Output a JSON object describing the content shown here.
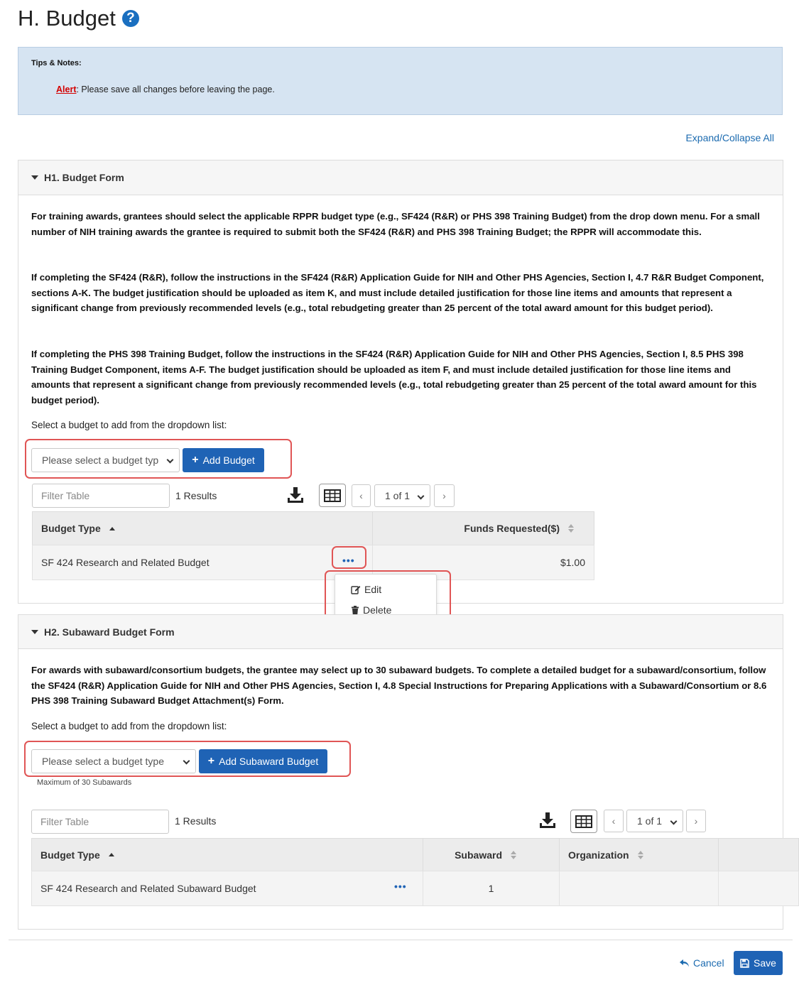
{
  "page": {
    "title": "H. Budget",
    "help_icon": "question-circle-icon"
  },
  "tips": {
    "title": "Tips & Notes:",
    "alert_label": "Alert",
    "alert_text": ": Please save all changes before leaving the page."
  },
  "expand_collapse_label": "Expand/Collapse All",
  "h1": {
    "title": "H1. Budget Form",
    "paragraphs": [
      "For training awards, grantees should select the applicable RPPR budget type (e.g., SF424 (R&R) or PHS 398 Training Budget) from the drop down menu. For a small number of NIH training awards the grantee is required to submit both the SF424 (R&R) and PHS 398 Training Budget; the RPPR will accommodate this.",
      "If completing the SF424 (R&R), follow the instructions in the SF424 (R&R) Application Guide for NIH and Other PHS Agencies, Section I, 4.7 R&R Budget Component, sections A-K. The budget justification should be uploaded as item K, and must include detailed justification for those line items and amounts that represent a significant change from previously recommended levels (e.g., total rebudgeting greater than 25 percent of the total award amount for this budget period).",
      "If completing the PHS 398 Training Budget, follow the instructions in the SF424 (R&R) Application Guide for NIH and Other PHS Agencies, Section I, 8.5 PHS 398 Training Budget Component, items A-F. The budget justification should be uploaded as item F, and must include detailed justification for those line items and amounts that represent a significant change from previously recommended levels (e.g., total rebudgeting greater than 25 percent of the total award amount for this budget period)."
    ],
    "select_label": "Select a budget to add from the dropdown list:",
    "select_value": "Please select a budget typ",
    "add_button": "Add Budget",
    "filter_placeholder": "Filter Table",
    "results": "1 Results",
    "page_select": "1 of 1",
    "columns": [
      "Budget Type",
      "Funds Requested($)"
    ],
    "rows": [
      {
        "budget_type": "SF 424 Research and Related Budget",
        "funds": "$1.00"
      }
    ],
    "row_menu_trigger": "•••",
    "row_menu": [
      "Edit",
      "Delete"
    ]
  },
  "h2": {
    "title": "H2. Subaward Budget Form",
    "paragraph": "For awards with subaward/consortium budgets, the grantee may select up to 30 subaward budgets. To complete a detailed budget for a subaward/consortium, follow the SF424 (R&R) Application Guide for NIH and Other PHS Agencies, Section I, 4.8 Special Instructions for Preparing Applications with a Subaward/Consortium or 8.6 PHS 398 Training Subaward Budget Attachment(s) Form.",
    "select_label": "Select a budget to add from the dropdown list:",
    "select_value": "Please select a budget type",
    "add_button": "Add Subaward Budget",
    "max_note": "Maximum of 30 Subawards",
    "filter_placeholder": "Filter Table",
    "results": "1 Results",
    "page_select": "1 of 1",
    "columns": [
      "Budget Type",
      "Subaward",
      "Organization"
    ],
    "rows": [
      {
        "budget_type": "SF 424 Research and Related Subaward Budget",
        "subaward": "1",
        "organization": ""
      }
    ],
    "row_menu_trigger": "•••"
  },
  "footer": {
    "cancel": "Cancel",
    "save": "Save"
  }
}
